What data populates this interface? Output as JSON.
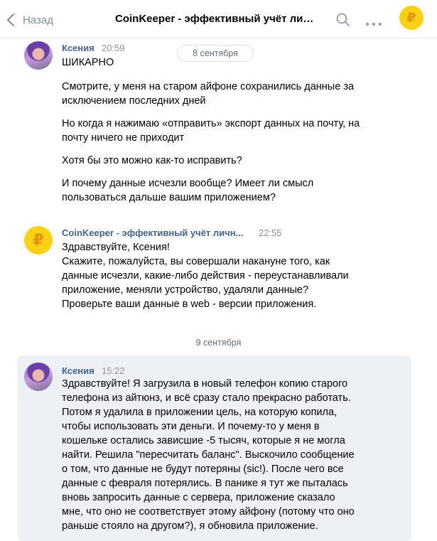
{
  "header": {
    "back_label": "Назад",
    "title": "CoinKeeper - эффективный учёт лич...",
    "avatar_symbol": "₽"
  },
  "date_pill": "8 сентября",
  "date_separator": "9 сентября",
  "messages": [
    {
      "author": "Ксения",
      "time": "20:59",
      "paragraphs": [
        "ШИКАРНО",
        "Смотрите, у меня на старом айфоне сохранились данные за исключением последних дней",
        "Но когда я нажимаю «отправить» экспорт данных на почту, на почту ничего не приходит",
        "Хотя бы это можно как-то исправить?",
        "И почему данные исчезли вообще? Имеет ли смысл пользоваться дальше вашим приложением?"
      ]
    },
    {
      "author": "CoinKeeper - эффективный учёт личн...",
      "time": "22:55",
      "avatar_symbol": "₽",
      "paragraphs": [
        "Здравствуйте, Ксения!",
        "Скажите, пожалуйста, вы совершали накануне того, как данные исчезли, какие-либо действия - переустанавливали приложение, меняли устройство, удаляли данные?",
        "Проверьте ваши данные в web - версии приложения."
      ]
    },
    {
      "author": "Ксения",
      "time": "15:22",
      "paragraphs": [
        "Здравствуйте! Я загрузила в новый телефон копию старого телефона из айтюнз, и всё сразу стало прекрасно работать. Потом я удалила в приложении цель, на которую копила, чтобы использовать эти деньги. И почему-то у меня в кошельке остались зависшие -5 тысяч, которые я не могла найти. Решила \"пересчитать баланс\". Выскочило сообщение о том, что данные не будут потеряны (sic!). После чего все данные с февраля потерялись. В панике я тут же пыталась вновь запросить данные с сервера, приложение сказало мне, что оно не соответствует этому айфону (потому что оно раньше стояло на другом?), я обновила приложение."
      ]
    }
  ],
  "colors": {
    "author": "#42648b",
    "accent_yellow": "#fcd114",
    "highlight_bg": "#edf0f5"
  }
}
